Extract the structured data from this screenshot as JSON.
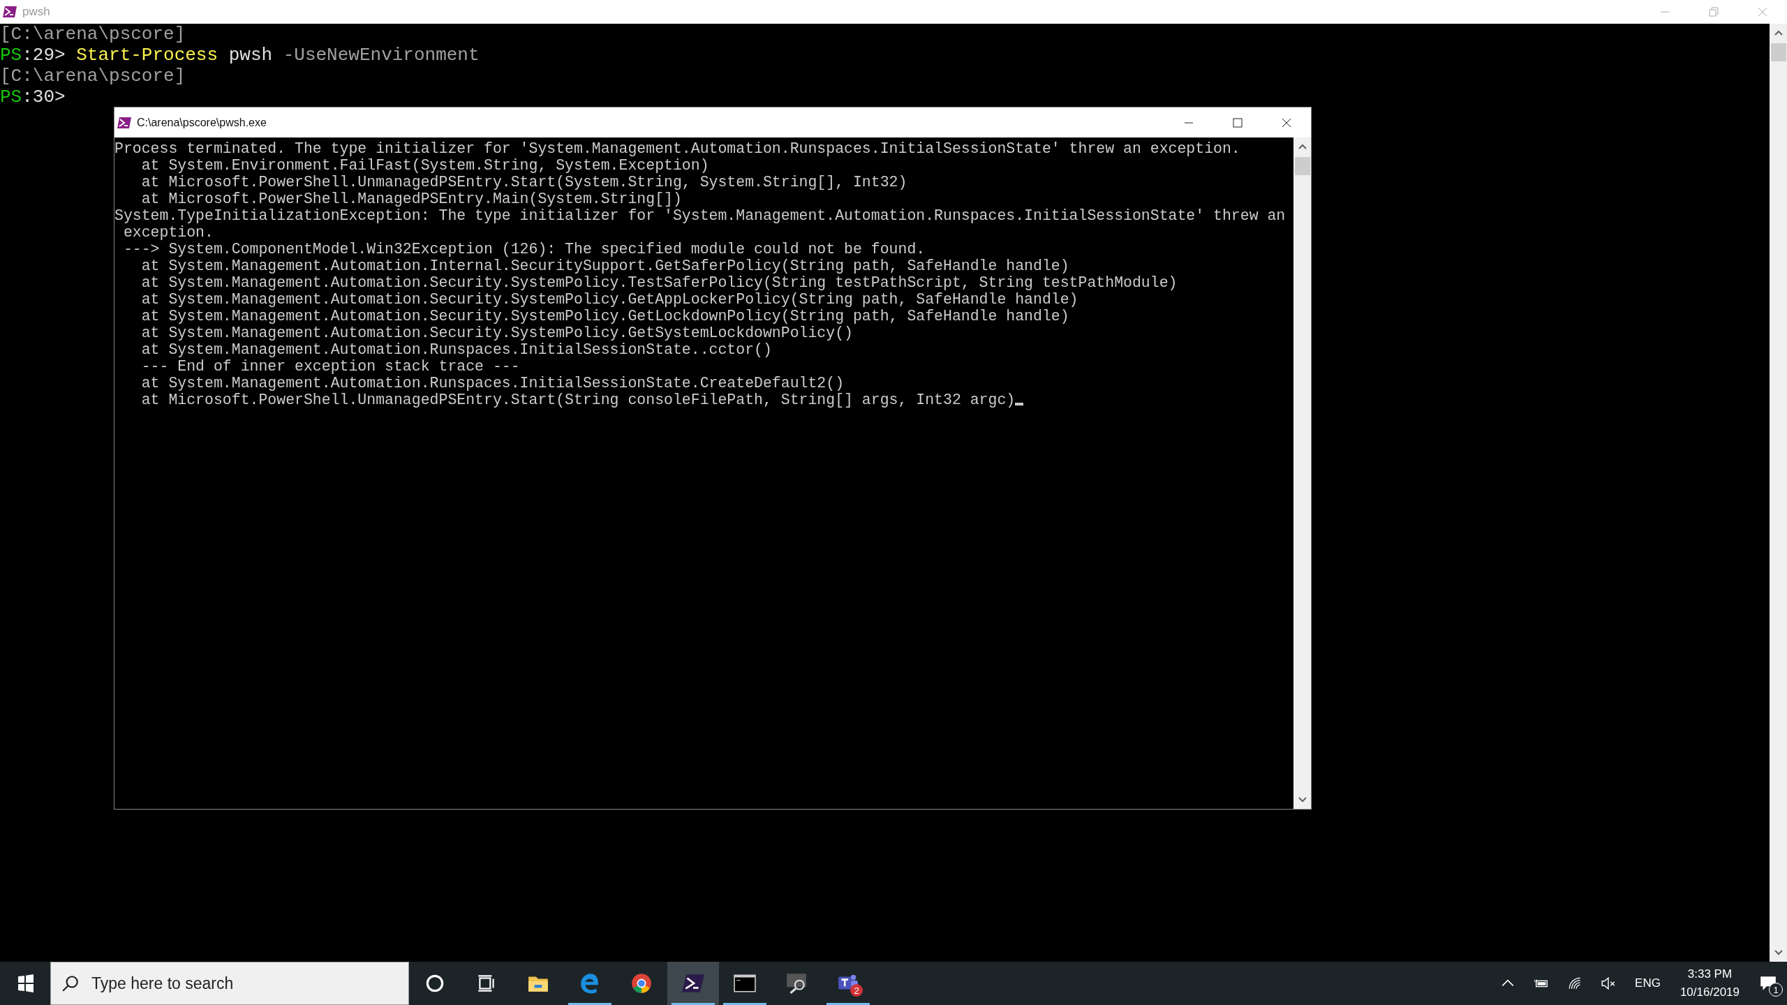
{
  "window": {
    "title": "pwsh"
  },
  "console": {
    "lines": [
      [
        {
          "kind": "path",
          "text": "[C:\\arena\\pscore]"
        }
      ],
      [
        {
          "kind": "prompt",
          "text": "PS"
        },
        {
          "kind": "plain",
          "text": ":29> "
        },
        {
          "kind": "command",
          "text": "Start-Process"
        },
        {
          "kind": "plain",
          "text": " pwsh "
        },
        {
          "kind": "parameter",
          "text": "-UseNewEnvironment"
        }
      ],
      [
        {
          "kind": "path",
          "text": "[C:\\arena\\pscore]"
        }
      ],
      [
        {
          "kind": "prompt",
          "text": "PS"
        },
        {
          "kind": "plain",
          "text": ":30>"
        }
      ]
    ]
  },
  "child_window": {
    "title": "C:\\arena\\pscore\\pwsh.exe",
    "cursor_visible": true,
    "lines": [
      "Process terminated. The type initializer for 'System.Management.Automation.Runspaces.InitialSessionState' threw an exception.",
      "   at System.Environment.FailFast(System.String, System.Exception)",
      "   at Microsoft.PowerShell.UnmanagedPSEntry.Start(System.String, System.String[], Int32)",
      "   at Microsoft.PowerShell.ManagedPSEntry.Main(System.String[])",
      "System.TypeInitializationException: The type initializer for 'System.Management.Automation.Runspaces.InitialSessionState' threw an",
      " exception.",
      " ---> System.ComponentModel.Win32Exception (126): The specified module could not be found.",
      "   at System.Management.Automation.Internal.SecuritySupport.GetSaferPolicy(String path, SafeHandle handle)",
      "   at System.Management.Automation.Security.SystemPolicy.TestSaferPolicy(String testPathScript, String testPathModule)",
      "   at System.Management.Automation.Security.SystemPolicy.GetAppLockerPolicy(String path, SafeHandle handle)",
      "   at System.Management.Automation.Security.SystemPolicy.GetLockdownPolicy(String path, SafeHandle handle)",
      "   at System.Management.Automation.Security.SystemPolicy.GetSystemLockdownPolicy()",
      "   at System.Management.Automation.Runspaces.InitialSessionState..cctor()",
      "   --- End of inner exception stack trace ---",
      "   at System.Management.Automation.Runspaces.InitialSessionState.CreateDefault2()",
      "   at Microsoft.PowerShell.UnmanagedPSEntry.Start(String consoleFilePath, String[] args, Int32 argc)"
    ]
  },
  "taskbar": {
    "search": {
      "placeholder": "Type here to search"
    },
    "apps": [
      {
        "kind": "cortana",
        "running": false,
        "selected": false
      },
      {
        "kind": "taskview",
        "running": false,
        "selected": false
      },
      {
        "kind": "explorer",
        "running": false,
        "selected": false
      },
      {
        "kind": "edge",
        "running": true,
        "selected": false
      },
      {
        "kind": "chrome",
        "running": false,
        "selected": false
      },
      {
        "kind": "pwsh",
        "running": true,
        "selected": true
      },
      {
        "kind": "terminal",
        "running": true,
        "selected": false
      },
      {
        "kind": "magnifier",
        "running": false,
        "selected": false
      },
      {
        "kind": "teams",
        "running": true,
        "selected": false,
        "badge": "2"
      }
    ],
    "language": "ENG",
    "time": "3:33 PM",
    "date": "10/16/2019",
    "notifications": "1"
  }
}
